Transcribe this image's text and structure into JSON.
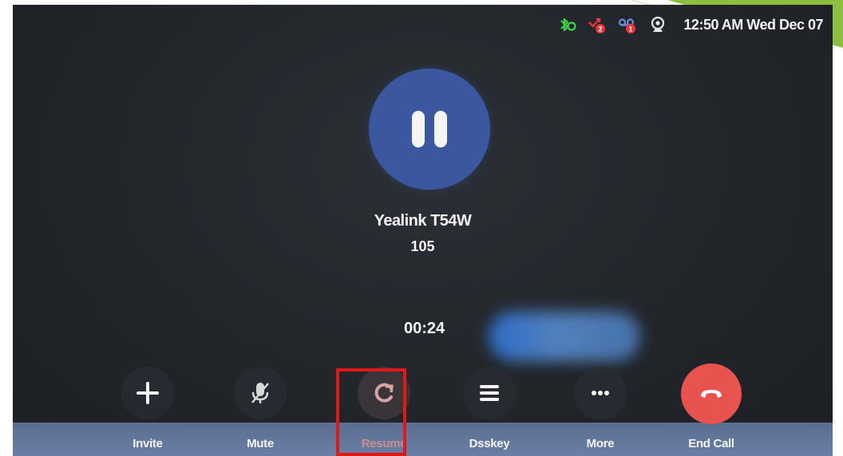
{
  "status_bar": {
    "icons": [
      "bluetooth-icon",
      "missed-call-icon",
      "voicemail-icon",
      "webcam-icon"
    ],
    "missed_calls_count": "2",
    "voicemail_count": "1",
    "clock": "12:50 AM Wed Dec 07"
  },
  "call": {
    "state_icon": "pause-icon",
    "caller_name": "Yealink T54W",
    "caller_number": "105",
    "duration": "00:24"
  },
  "toolbar": {
    "invite_label": "Invite",
    "mute_label": "Mute",
    "resume_label": "Resume",
    "dsskey_label": "Dsskey",
    "more_label": "More",
    "end_call_label": "End Call"
  },
  "colors": {
    "avatar": "#3b57a0",
    "end_call": "#e8534f",
    "highlight": "#e01818",
    "bluetooth": "#3fd34a",
    "badge": "#e8343a"
  }
}
